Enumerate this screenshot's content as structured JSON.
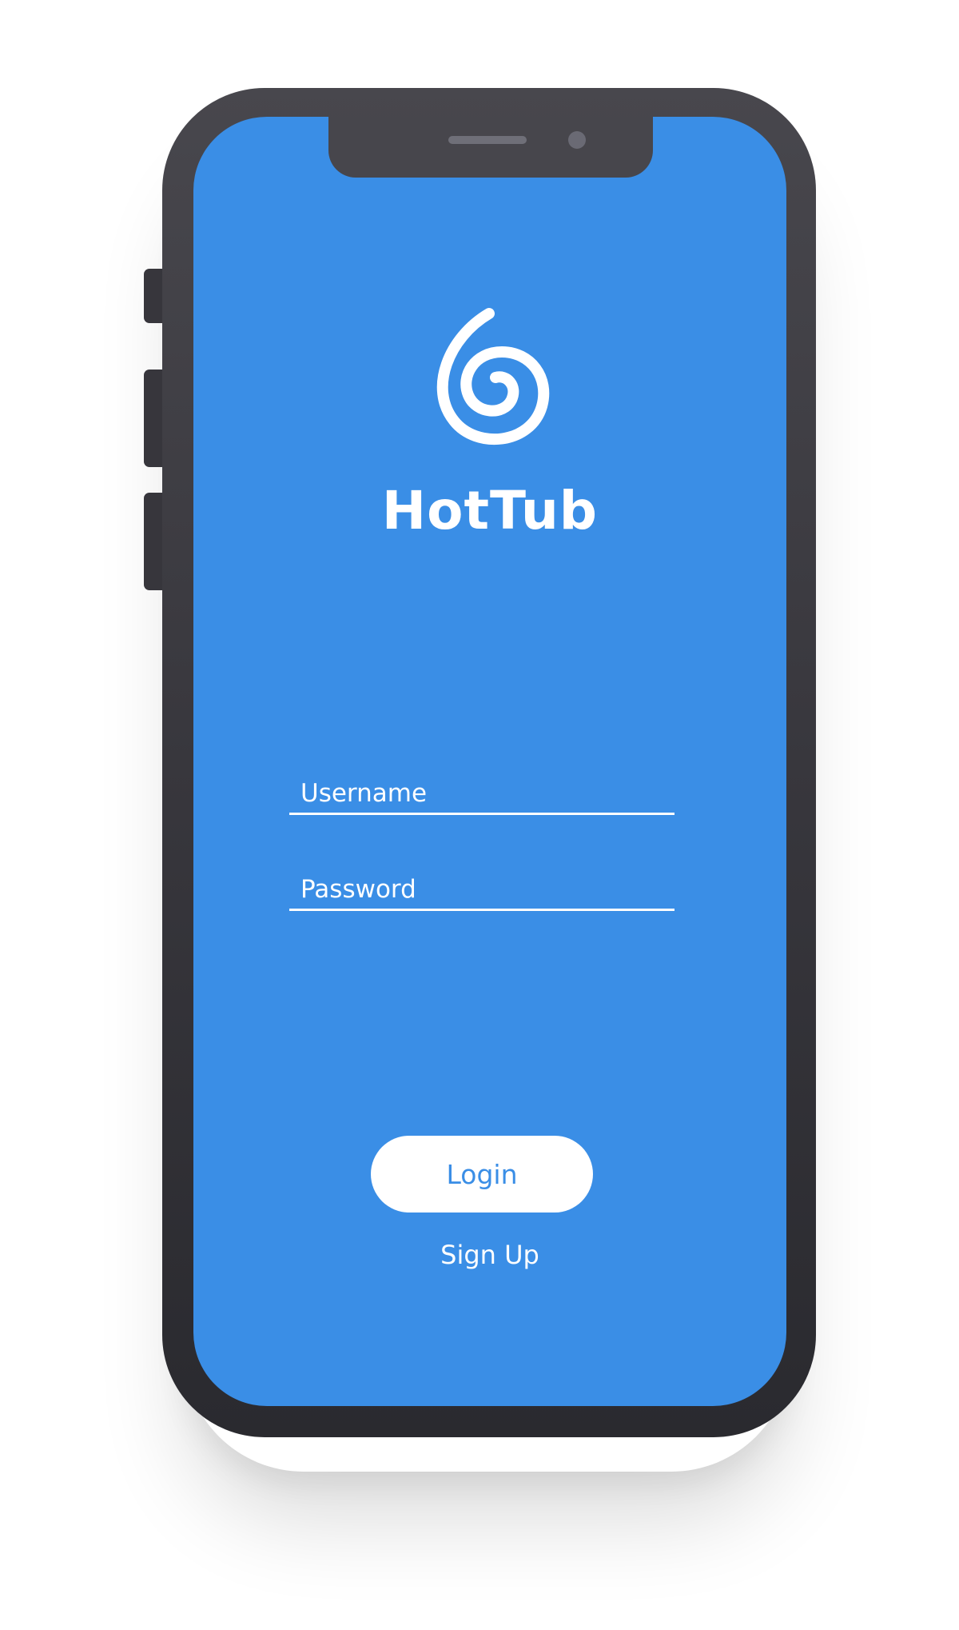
{
  "app": {
    "name": "HotTub",
    "logo_icon": "spiral-icon",
    "accent_color": "#3a8ee6"
  },
  "login_form": {
    "username_placeholder": "Username",
    "username_value": "",
    "password_placeholder": "Password",
    "password_value": ""
  },
  "actions": {
    "login_label": "Login",
    "signup_label": "Sign Up"
  }
}
